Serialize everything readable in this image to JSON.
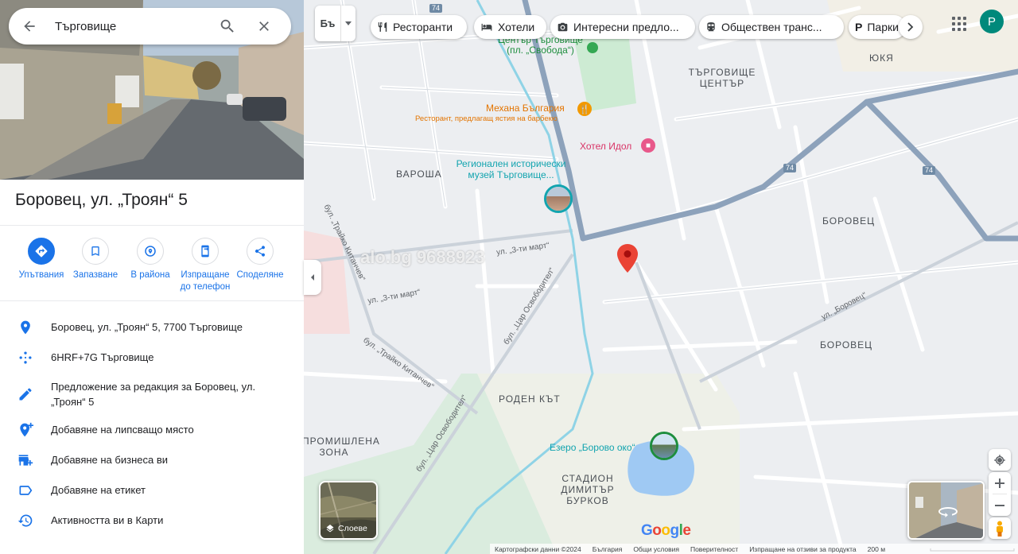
{
  "search": {
    "value": "Търговище"
  },
  "place": {
    "title": "Боровец, ул. „Троян“ 5"
  },
  "actions": [
    {
      "label": "Упътвания"
    },
    {
      "label": "Запазване"
    },
    {
      "label": "В района"
    },
    {
      "label": "Изпращане до телефон"
    },
    {
      "label": "Споделяне"
    }
  ],
  "info_rows": [
    {
      "icon": "location-pin-icon",
      "text": "Боровец, ул. „Троян“ 5, 7700 Търговище"
    },
    {
      "icon": "plus-code-icon",
      "text": "6HRF+7G Търговище"
    },
    {
      "icon": "edit-pencil-icon",
      "text": "Предложение за редакция за Боровец, ул. „Троян“ 5"
    },
    {
      "icon": "add-place-icon",
      "text": "Добавяне на липсващо място"
    },
    {
      "icon": "add-business-icon",
      "text": "Добавяне на бизнеса ви"
    },
    {
      "icon": "label-icon",
      "text": "Добавяне на етикет"
    },
    {
      "icon": "history-icon",
      "text": "Активността ви в Карти"
    }
  ],
  "language_button": "Бъ",
  "chips": [
    {
      "icon": "restaurant-icon",
      "label": "Ресторанти"
    },
    {
      "icon": "hotel-icon",
      "label": "Хотели"
    },
    {
      "icon": "camera-icon",
      "label": "Интересни предло..."
    },
    {
      "icon": "transit-icon",
      "label": "Обществен транс..."
    },
    {
      "icon": "parking-icon",
      "label": "Парки"
    }
  ],
  "avatar_letter": "P",
  "map_labels": {
    "torgovishte_center": "ТЪРГОВИЩЕ ЦЕНТЪР",
    "yuka": "ЮКЯ",
    "varosha": "ВАРОША",
    "borovets_1": "БОРОВЕЦ",
    "borovets_2": "БОРОВЕЦ",
    "roden_kat": "РОДЕН КЪТ",
    "industrial_zone": "ПРОМИШЛЕНА ЗОНА",
    "stadium": "СТАДИОН ДИМИТЪР БУРКОВ"
  },
  "pois": {
    "center_square": "Център Търговище (пл. „Свобода“)",
    "mehana_name": "Механа България",
    "mehana_desc": "Ресторант, предлагащ ястия на барбекю",
    "hotel": "Хотел Идол",
    "museum": "Регионален исторически музей Търговище...",
    "lake": "Езеро „Борово око“"
  },
  "road_labels": {
    "tri_mart_1": "ул. „3-ти март“",
    "tri_mart_2": "ул. „3-ти март“",
    "tsar_osvoboditel_1": "бул. „Цар Освободител“",
    "tsar_osvoboditel_2": "бул. „Цар Освободител“",
    "traiko_1": "бул. „Трайко Китанчев“",
    "traiko_2": "бул. „Трайко Китанчев“",
    "borovets_street": "ул. „Боровец“",
    "shield_74_a": "74",
    "shield_74_b": "74",
    "shield_74_c": "74"
  },
  "layers_label": "Слоеве",
  "watermark": "alo.bg 9688923",
  "google_logo": "Google",
  "footer": {
    "map_data": "Картографски данни ©2024",
    "country": "България",
    "terms": "Общи условия",
    "privacy": "Поверителност",
    "feedback": "Изпращане на отзиви за продукта",
    "scale": "200 м"
  },
  "colors": {
    "accent": "#1a73e8",
    "pin": "#ea4335",
    "water": "#9fc9f3",
    "park": "#c8e6c9",
    "highway": "#8da2bb",
    "avatar": "#00897b"
  }
}
